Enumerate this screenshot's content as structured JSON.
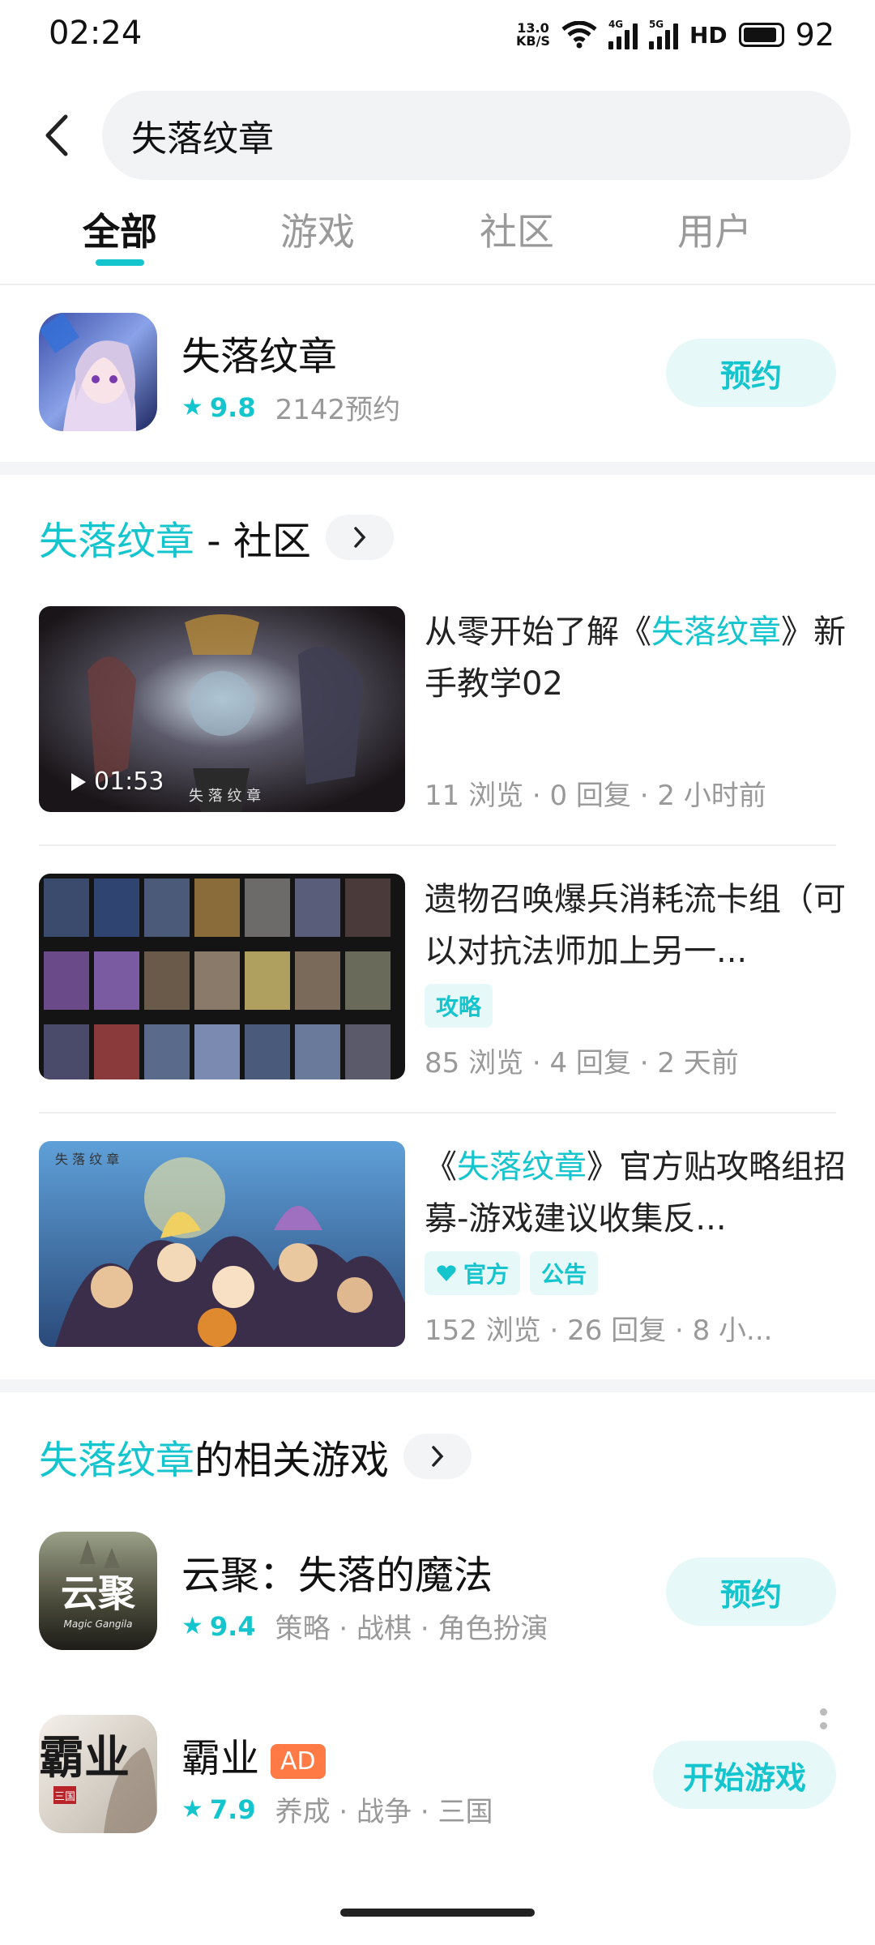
{
  "status_bar": {
    "time": "02:24",
    "net_speed_value": "13.0",
    "net_speed_unit": "KB/S",
    "sim1": "4G",
    "sim2": "5G",
    "hd": "HD",
    "battery": "92"
  },
  "search": {
    "query": "失落纹章"
  },
  "tabs": [
    {
      "label": "全部",
      "active": true
    },
    {
      "label": "游戏",
      "active": false
    },
    {
      "label": "社区",
      "active": false
    },
    {
      "label": "用户",
      "active": false
    }
  ],
  "top_app": {
    "name": "失落纹章",
    "rating": "9.8",
    "reservations": "2142预约",
    "button": "预约"
  },
  "community": {
    "title_highlight": "失落纹章",
    "title_rest": " - 社区",
    "posts": [
      {
        "title_pre": "从零开始了解《",
        "title_hl": "失落纹章",
        "title_post": "》新手教学02",
        "duration": "01:53",
        "meta": "11 浏览 · 0 回复 · 2 小时前",
        "tags": []
      },
      {
        "title_pre": "遗物召唤爆兵消耗流卡组（可以对抗法师加上另一...",
        "title_hl": "",
        "title_post": "",
        "meta": "85 浏览 · 4 回复 · 2 天前",
        "tags": [
          "攻略"
        ]
      },
      {
        "title_pre": "《",
        "title_hl": "失落纹章",
        "title_post": "》官方贴攻略组招募-游戏建议收集反...",
        "meta": "152 浏览 · 26 回复 · 8 小...",
        "tags": [
          "官方",
          "公告"
        ]
      }
    ]
  },
  "related": {
    "title_highlight": "失落纹章",
    "title_rest": "的相关游戏",
    "games": [
      {
        "name": "云聚：失落的魔法",
        "rating": "9.4",
        "genres": "策略 · 战棋 · 角色扮演",
        "button": "预约",
        "icon_text": "云聚",
        "icon_sub": "Magic Gangila"
      },
      {
        "name": "霸业",
        "ad": "AD",
        "rating": "7.9",
        "genres": "养成 · 战争 · 三国",
        "button": "开始游戏",
        "icon_text": "霸业",
        "icon_sub": "三国"
      }
    ]
  },
  "colors": {
    "accent": "#15c5ce",
    "accent_bg": "#e6f8f8",
    "ad": "#ff7a45"
  }
}
